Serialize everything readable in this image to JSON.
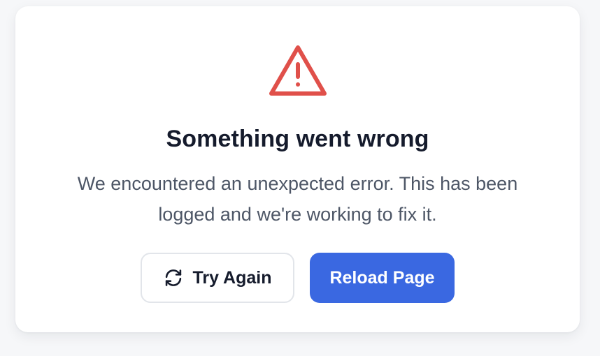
{
  "colors": {
    "page_background": "#f6f7f9",
    "card_background": "#ffffff",
    "warning_icon": "#e0504a",
    "title_text": "#151b2c",
    "message_text": "#4d5666",
    "primary_button": "#3a68e1",
    "secondary_border": "#e2e5ea"
  },
  "error_card": {
    "icon": "warning-triangle-icon",
    "title": "Something went wrong",
    "message_line_1": "We encountered an unexpected error. This has been",
    "message_line_2": "logged and we're working to fix it."
  },
  "actions": {
    "try_again": {
      "label": "Try Again",
      "icon": "refresh-icon"
    },
    "reload_page": {
      "label": "Reload Page"
    }
  }
}
